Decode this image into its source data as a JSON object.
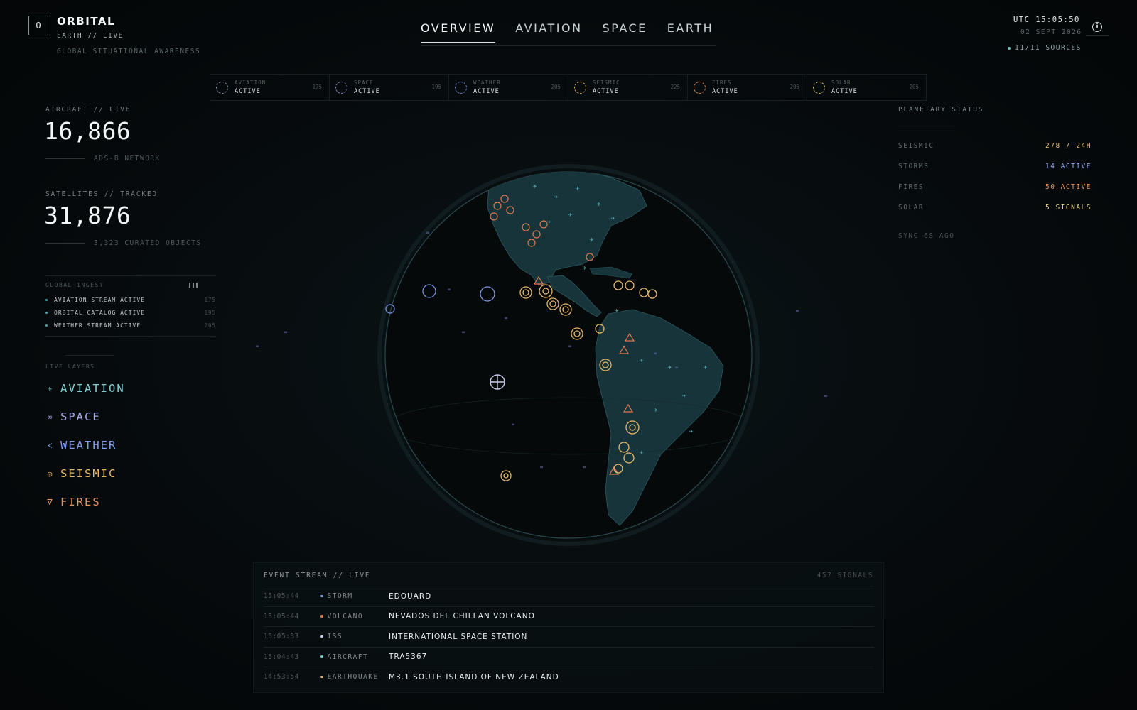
{
  "brand": {
    "logo_letter": "O",
    "name": "ORBITAL",
    "subtitle": "EARTH // LIVE",
    "tagline": "GLOBAL SITUATIONAL AWARENESS"
  },
  "nav": {
    "tabs": [
      {
        "label": "OVERVIEW",
        "active": true
      },
      {
        "label": "AVIATION",
        "active": false
      },
      {
        "label": "SPACE",
        "active": false
      },
      {
        "label": "EARTH",
        "active": false
      }
    ]
  },
  "topright": {
    "utc": "UTC 15:05:50",
    "date": "02 SEPT 2026",
    "sources": "11/11 SOURCES",
    "info_icon": "info-icon"
  },
  "streams": [
    {
      "label": "AVIATION",
      "status": "ACTIVE",
      "count": "175",
      "color": "#7a8c9c"
    },
    {
      "label": "SPACE",
      "status": "ACTIVE",
      "count": "195",
      "color": "#7b7fb8"
    },
    {
      "label": "WEATHER",
      "status": "ACTIVE",
      "count": "205",
      "color": "#6a7fc0"
    },
    {
      "label": "SEISMIC",
      "status": "ACTIVE",
      "count": "225",
      "color": "#c9a24a"
    },
    {
      "label": "FIRES",
      "status": "ACTIVE",
      "count": "205",
      "color": "#d07a45"
    },
    {
      "label": "SOLAR",
      "status": "ACTIVE",
      "count": "205",
      "color": "#c9b860"
    }
  ],
  "aircraft": {
    "label": "AIRCRAFT // LIVE",
    "value": "16,866",
    "sub": "ADS-B NETWORK"
  },
  "satellites": {
    "label": "SATELLITES // TRACKED",
    "value": "31,876",
    "sub": "3,323 CURATED OBJECTS"
  },
  "ingest": {
    "title": "GLOBAL INGEST",
    "rows": [
      {
        "label": "AVIATION STREAM ACTIVE",
        "count": "175"
      },
      {
        "label": "ORBITAL CATALOG ACTIVE",
        "count": "195"
      },
      {
        "label": "WEATHER STREAM ACTIVE",
        "count": "205"
      }
    ]
  },
  "layers": {
    "title": "LIVE LAYERS",
    "items": [
      {
        "label": "AVIATION",
        "icon": "plane-icon",
        "glyph": "✈",
        "color": "#7fd3d6"
      },
      {
        "label": "SPACE",
        "icon": "satellite-icon",
        "glyph": "∞",
        "color": "#a7a9ec"
      },
      {
        "label": "WEATHER",
        "icon": "storm-icon",
        "glyph": "≺",
        "color": "#7fa0ec"
      },
      {
        "label": "SEISMIC",
        "icon": "seismic-icon",
        "glyph": "◎",
        "color": "#e7b86a"
      },
      {
        "label": "FIRES",
        "icon": "fire-icon",
        "glyph": "ᐁ",
        "color": "#e58f5c"
      }
    ]
  },
  "planetary": {
    "title": "PLANETARY STATUS",
    "rows": [
      {
        "key": "SEISMIC",
        "value": "278 / 24H",
        "color": "#e7c37a"
      },
      {
        "key": "STORMS",
        "value": "14 ACTIVE",
        "color": "#8aa4f0"
      },
      {
        "key": "FIRES",
        "value": "50 ACTIVE",
        "color": "#e6935e"
      },
      {
        "key": "SOLAR",
        "value": "5 SIGNALS",
        "color": "#e7d98a"
      }
    ],
    "sync": "SYNC 6S AGO"
  },
  "events": {
    "title": "EVENT STREAM // LIVE",
    "count": "457 SIGNALS",
    "rows": [
      {
        "time": "15:05:44",
        "category": "STORM",
        "title": "EDOUARD",
        "color": "#7f9cf0"
      },
      {
        "time": "15:05:44",
        "category": "VOLCANO",
        "title": "NEVADOS DEL CHILLAN VOLCANO",
        "color": "#e07a50"
      },
      {
        "time": "15:05:33",
        "category": "ISS",
        "title": "INTERNATIONAL SPACE STATION",
        "color": "#c9c9e6"
      },
      {
        "time": "15:04:43",
        "category": "AIRCRAFT",
        "title": "TRA5367",
        "color": "#6fc9c9"
      },
      {
        "time": "14:53:54",
        "category": "EARTHQUAKE",
        "title": "M3.1 SOUTH ISLAND OF NEW ZEALAND",
        "color": "#e7b86a"
      }
    ]
  }
}
